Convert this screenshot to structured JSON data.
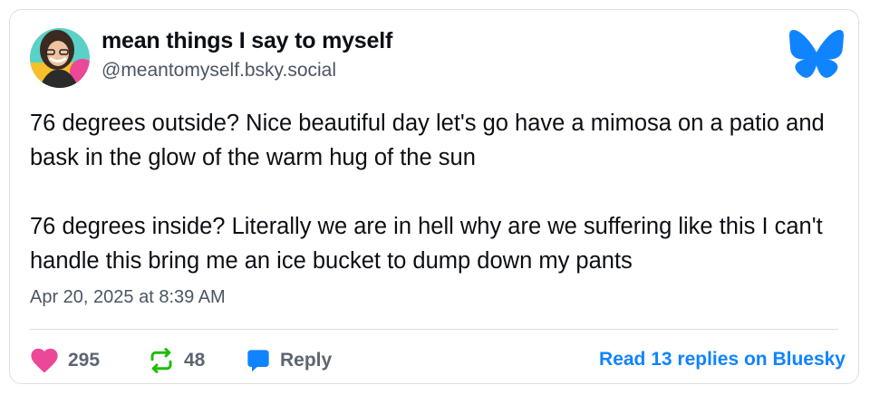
{
  "post": {
    "author_name": "mean things I say to myself",
    "handle": "@meantomyself.bsky.social",
    "paragraph_1": "76 degrees outside? Nice beautiful day let's go have a mimosa on a patio and bask in the glow of the warm hug of the sun",
    "paragraph_2": "76 degrees inside? Literally we are in hell why are we suffering like this I can't handle this bring me an ice bucket to dump down my pants",
    "timestamp": "Apr 20, 2025 at 8:39 AM"
  },
  "actions": {
    "likes": "295",
    "reposts": "48",
    "reply_label": "Reply",
    "read_replies_label": "Read 13 replies on Bluesky"
  },
  "icons": {
    "like": "heart-icon",
    "repost": "repost-icon",
    "reply": "reply-bubble-icon",
    "logo": "bluesky-butterfly-icon"
  },
  "colors": {
    "like": "#ec4899",
    "repost": "#20bc07",
    "reply": "#1083fe",
    "brand": "#1083fe",
    "text": "#0b0f14",
    "muted": "#4b5563"
  }
}
